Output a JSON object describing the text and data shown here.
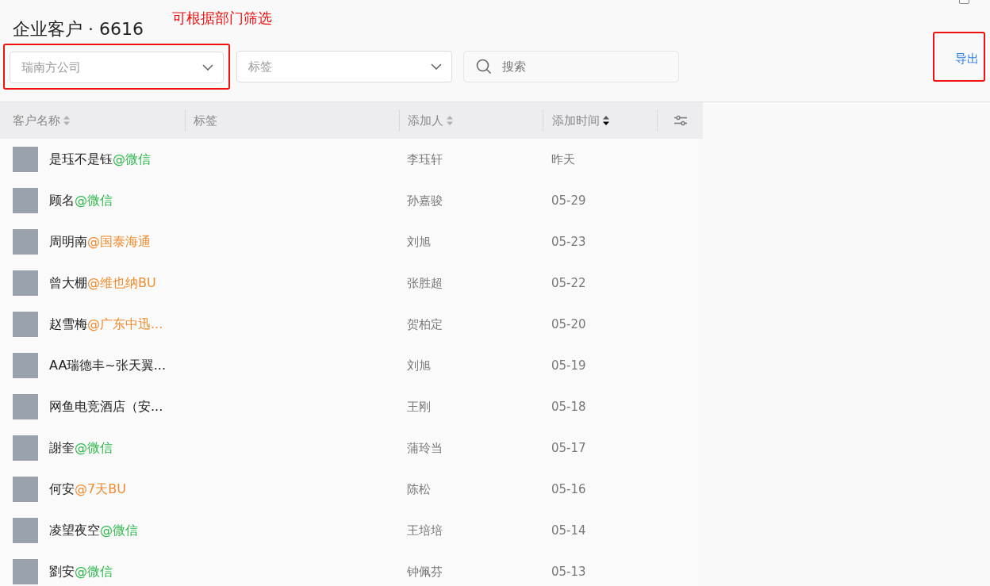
{
  "annotation": {
    "note": "可根据部门筛选"
  },
  "header": {
    "title": "企业客户 · 6616"
  },
  "filters": {
    "department": {
      "value": "瑞南方公司",
      "highlighted": true
    },
    "tag": {
      "placeholder": "标签"
    },
    "search": {
      "placeholder": "搜索"
    }
  },
  "export": {
    "label": "导出",
    "highlighted": true
  },
  "table": {
    "columns": [
      {
        "label": "客户名称",
        "sortable": true,
        "sorted_desc": false
      },
      {
        "label": "标签",
        "sortable": false
      },
      {
        "label": "添加人",
        "sortable": true,
        "sorted_desc": false
      },
      {
        "label": "添加时间",
        "sortable": true,
        "sorted_desc": true
      }
    ],
    "rows": [
      {
        "name": "是珏不是钰",
        "corp": "@微信",
        "color": "#2fb84d",
        "added_by": "李珏轩",
        "added_at": "昨天"
      },
      {
        "name": "顾名",
        "corp": "@微信",
        "color": "#2fb84d",
        "added_by": "孙嘉骏",
        "added_at": "05-29"
      },
      {
        "name": "周明南",
        "corp": "@国泰海通",
        "color": "#f08c2e",
        "added_by": "刘旭",
        "added_at": "05-23"
      },
      {
        "name": "曾大棚",
        "corp": "@维也纳BU",
        "color": "#f08c2e",
        "added_by": "张胜超",
        "added_at": "05-22"
      },
      {
        "name": "赵雪梅",
        "corp": "@广东中迅...",
        "color": "#f08c2e",
        "added_by": "贺柏定",
        "added_at": "05-20"
      },
      {
        "name": "AA瑞德丰~张天翼...",
        "added_by": "刘旭",
        "added_at": "05-19"
      },
      {
        "name": "网鱼电竞酒店（安...",
        "added_by": "王刚",
        "added_at": "05-18"
      },
      {
        "name": "謝奎",
        "corp": "@微信",
        "color": "#2fb84d",
        "added_by": "蒲玲当",
        "added_at": "05-17"
      },
      {
        "name": "何安",
        "corp": "@7天BU",
        "color": "#f08c2e",
        "added_by": "陈松",
        "added_at": "05-16"
      },
      {
        "name": "凌望夜空",
        "corp": "@微信",
        "color": "#2fb84d",
        "added_by": "王培培",
        "added_at": "05-14"
      },
      {
        "name": "劉安",
        "corp": "@微信",
        "color": "#2fb84d",
        "added_by": "钟佩芬",
        "added_at": "05-13"
      }
    ]
  }
}
